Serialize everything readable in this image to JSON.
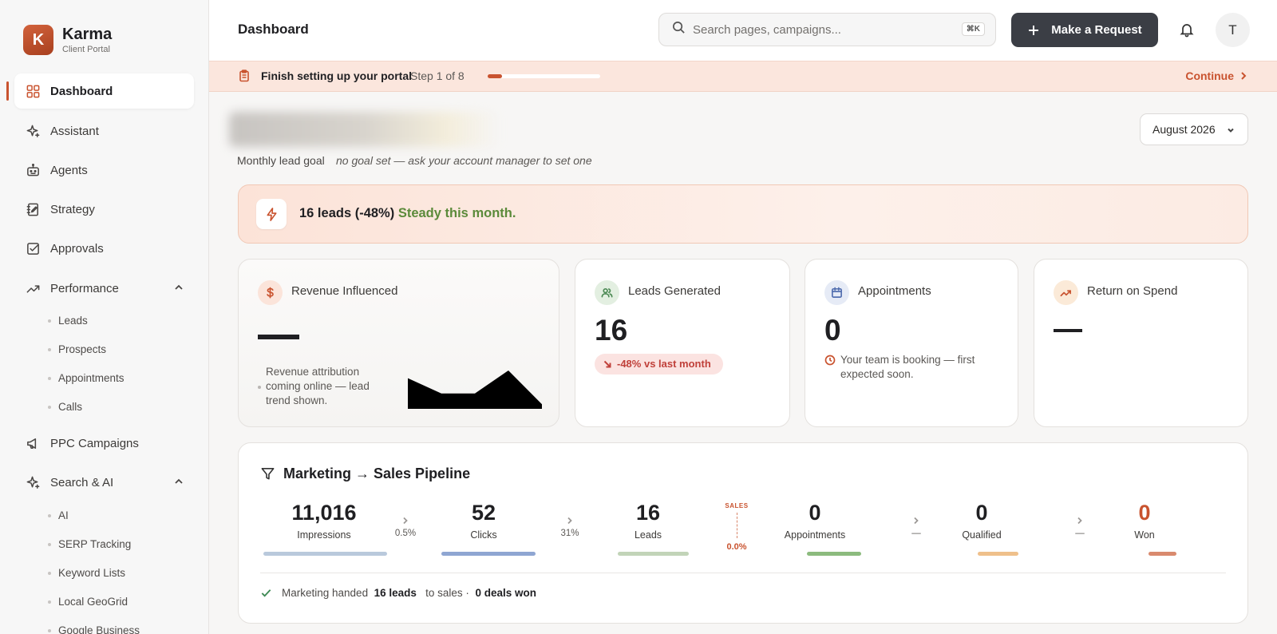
{
  "brand": {
    "initial": "K",
    "name": "Karma",
    "subtitle": "Client Portal"
  },
  "sidebar": {
    "items": [
      {
        "label": "Dashboard",
        "icon": "grid-icon",
        "active": true
      },
      {
        "label": "Assistant",
        "icon": "sparkle-icon"
      },
      {
        "label": "Agents",
        "icon": "robot-icon"
      },
      {
        "label": "Strategy",
        "icon": "notebook-icon"
      },
      {
        "label": "Approvals",
        "icon": "checkbox-icon"
      },
      {
        "label": "Performance",
        "icon": "trend-icon",
        "expanded": true
      },
      {
        "label": "PPC Campaigns",
        "icon": "megaphone-icon"
      },
      {
        "label": "Search & AI",
        "icon": "sparkle-icon",
        "expanded": true
      }
    ],
    "performance_children": [
      "Leads",
      "Prospects",
      "Appointments",
      "Calls"
    ],
    "search_children": [
      "AI",
      "SERP Tracking",
      "Keyword Lists",
      "Local GeoGrid",
      "Google Business"
    ]
  },
  "header": {
    "title": "Dashboard",
    "search_placeholder": "Search pages, campaigns...",
    "search_shortcut": "⌘K",
    "request_label": "Make a Request",
    "avatar_initial": "T"
  },
  "setup": {
    "title": "Finish setting up your portal",
    "step": "Step 1 of 8",
    "progress": 0.125,
    "continue_label": "Continue"
  },
  "main": {
    "month": "August 2026",
    "goal_label": "Monthly lead goal",
    "goal_note": "no goal set — ask your account manager to set one"
  },
  "insight": {
    "headline": "16 leads (-48%)",
    "status": "Steady this month."
  },
  "cards": {
    "revenue": {
      "title": "Revenue Influenced",
      "note": "Revenue attribution coming online — lead trend shown.",
      "trend": [
        2,
        1,
        1,
        2.5,
        0.3
      ]
    },
    "leads": {
      "title": "Leads Generated",
      "value": "16",
      "delta": "-48% vs last month"
    },
    "appointments": {
      "title": "Appointments",
      "value": "0",
      "note": "Your team is booking — first expected soon."
    },
    "roas": {
      "title": "Return on Spend"
    }
  },
  "pipeline": {
    "title": "Marketing → Sales Pipeline",
    "stages": [
      {
        "value": "11,016",
        "label": "Impressions",
        "color": "#b9c9dc"
      },
      {
        "value": "52",
        "label": "Clicks",
        "color": "#8fa6d2"
      },
      {
        "value": "16",
        "label": "Leads",
        "color": "#c2d4b8"
      },
      {
        "value": "0",
        "label": "Appointments",
        "color": "#8cbb7e"
      },
      {
        "value": "0",
        "label": "Qualified",
        "color": "#efc08b"
      },
      {
        "value": "0",
        "label": "Won",
        "color": "#d98a6e"
      }
    ],
    "conversions": [
      "0.5%",
      "31%",
      "—",
      "—"
    ],
    "sales_label": "SALES",
    "sales_rate": "0.0%",
    "footer": {
      "prefix": "Marketing handed",
      "leads": "16 leads",
      "middle": "to sales ·",
      "deals": "0 deals won"
    }
  }
}
